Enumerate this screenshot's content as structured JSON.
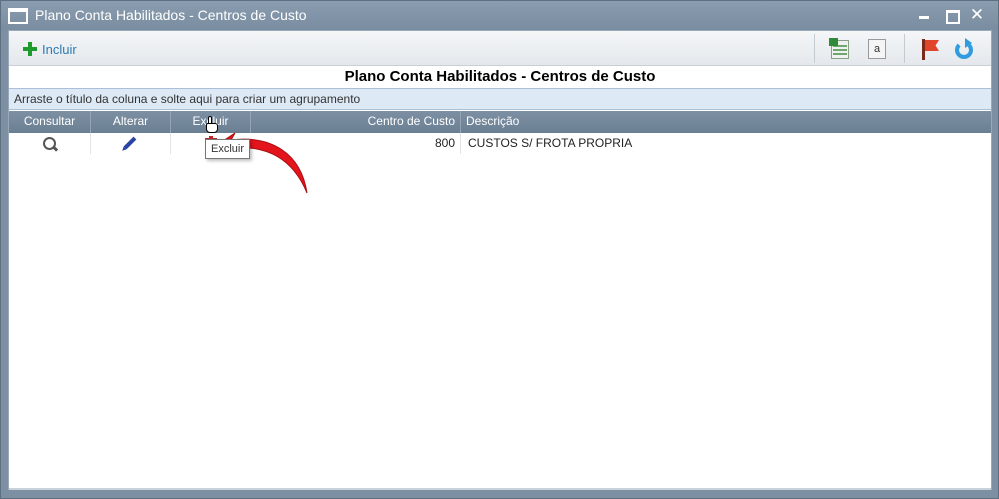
{
  "window": {
    "title": "Plano Conta Habilitados - Centros de Custo",
    "close_glyph": "✕"
  },
  "toolbar": {
    "add_label": "Incluir",
    "text_icon_glyph": "a",
    "icons": [
      "excel-export-icon",
      "text-export-icon",
      "flag-icon",
      "refresh-icon"
    ]
  },
  "report": {
    "title": "Plano Conta Habilitados - Centros de Custo"
  },
  "grid": {
    "group_panel_text": "Arraste o título da coluna e solte aqui para criar um agrupamento",
    "columns": [
      "Consultar",
      "Alterar",
      "Excluir",
      "Centro de Custo",
      "Descrição"
    ],
    "rows": [
      {
        "centro_de_custo": "800",
        "descricao": "CUSTOS S/ FROTA PROPRIA"
      }
    ],
    "tooltip": "Excluir"
  },
  "colors": {
    "titlebar": "#7d90a3",
    "accent_add": "#1f9a2c",
    "link": "#2d7ab3",
    "delete": "#c0262a",
    "arrow": "#e3141b"
  }
}
